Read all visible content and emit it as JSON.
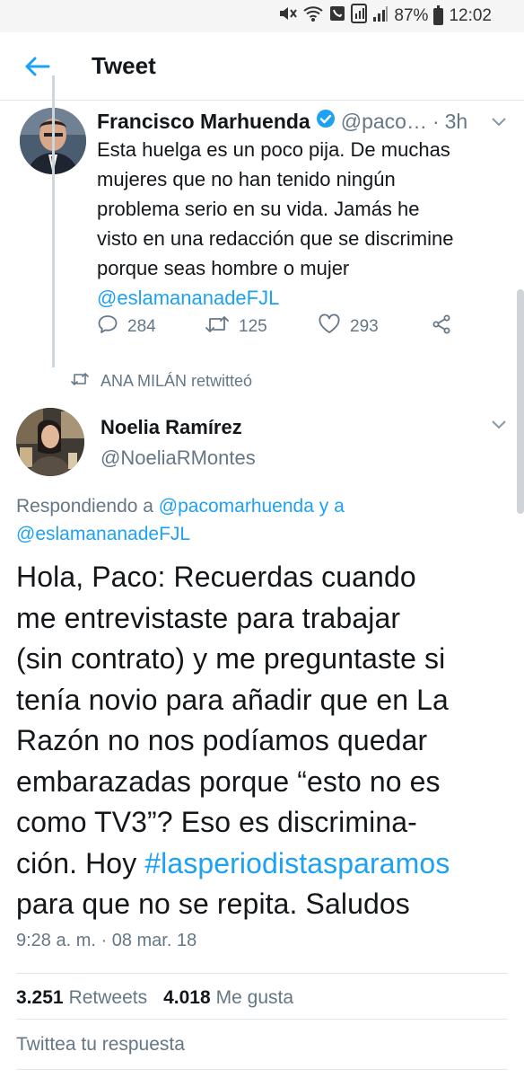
{
  "status_bar": {
    "battery": "87%",
    "time": "12:02"
  },
  "app_bar": {
    "title": "Tweet"
  },
  "parent_tweet": {
    "name": "Francisco Marhuenda",
    "handle": "@paco…",
    "separator": "·",
    "time": "3h",
    "text_lines": [
      "Esta huelga es un poco pija. De muchas",
      "mujeres que no han tenido ningún",
      "problema serio en su vida. Jamás he",
      "visto en una redacción que se discrimine",
      "porque seas hombre o mujer"
    ],
    "mention": "@eslamananadeFJL",
    "replies": "284",
    "retweets": "125",
    "likes": "293"
  },
  "retweet_label": "ANA MILÁN retwitteó",
  "main_tweet": {
    "name": "Noelia Ramírez",
    "handle": "@NoeliaRMontes",
    "replying_prefix": "Respondiendo a ",
    "replying_user1": "@pacomarhuenda",
    "replying_and": " y a",
    "replying_user2": "@eslamananadeFJL",
    "text_lines": [
      "Hola, Paco: Recuerdas cuando",
      "me entrevistaste para trabajar",
      "(sin contrato) y me preguntaste si",
      "tenía novio para añadir que en La",
      "Razón no nos podíamos quedar",
      "embarazadas porque “esto no es",
      "como TV3”? Eso es discrimina-"
    ],
    "line8_prefix": "ción. Hoy ",
    "hashtag": "#lasperiodistasparamos",
    "line9": "para que no se repita. Saludos",
    "timestamp": "9:28 a. m. · 08 mar. 18",
    "retweet_count": "3.251",
    "retweet_label": "Retweets",
    "like_count": "4.018",
    "like_label": "Me gusta"
  },
  "reply_placeholder": "Twittea tu respuesta",
  "colors": {
    "link": "#1da1f2",
    "secondary": "#657786",
    "primary_text": "#14171a"
  }
}
